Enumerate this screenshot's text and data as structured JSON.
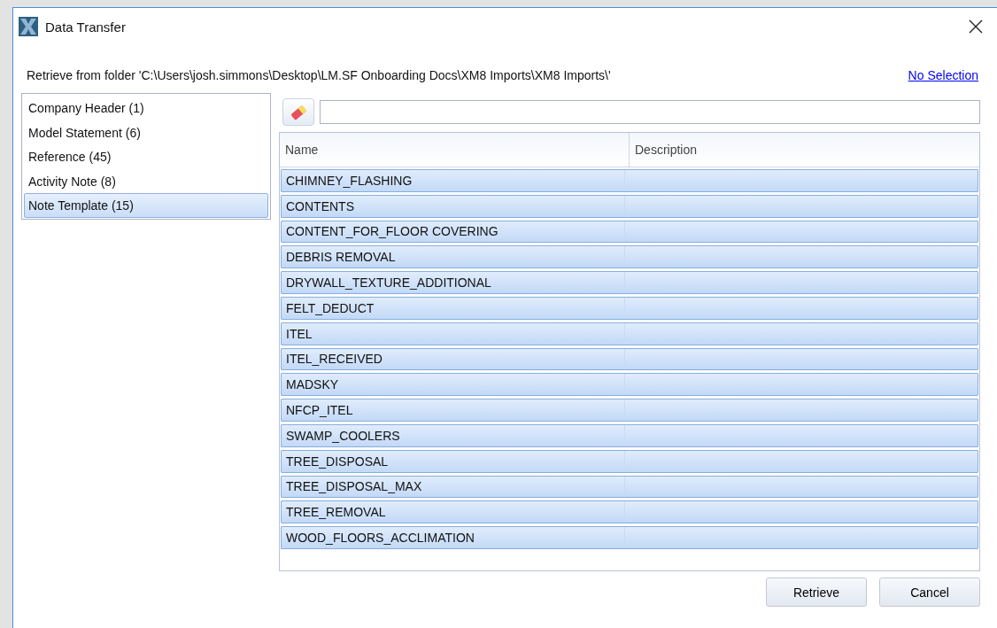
{
  "window": {
    "title": "Data Transfer"
  },
  "path_label": "Retrieve from folder 'C:\\Users\\josh.simmons\\Desktop\\LM.SF Onboarding Docs\\XM8 Imports\\XM8 Imports\\'",
  "no_selection_link": "No Selection",
  "categories": [
    {
      "label": "Company Header (1)",
      "selected": false
    },
    {
      "label": "Model Statement (6)",
      "selected": false
    },
    {
      "label": "Reference (45)",
      "selected": false
    },
    {
      "label": "Activity Note (8)",
      "selected": false
    },
    {
      "label": "Note Template (15)",
      "selected": true
    }
  ],
  "table": {
    "columns": [
      "Name",
      "Description"
    ],
    "rows": [
      {
        "name": "CHIMNEY_FLASHING",
        "selected": true
      },
      {
        "name": "CONTENTS",
        "selected": true
      },
      {
        "name": "CONTENT_FOR_FLOOR COVERING",
        "selected": true
      },
      {
        "name": "DEBRIS REMOVAL",
        "selected": true
      },
      {
        "name": "DRYWALL_TEXTURE_ADDITIONAL",
        "selected": true
      },
      {
        "name": "FELT_DEDUCT",
        "selected": true
      },
      {
        "name": "ITEL",
        "selected": true
      },
      {
        "name": "ITEL_RECEIVED",
        "selected": true
      },
      {
        "name": "MADSKY",
        "selected": true
      },
      {
        "name": "NFCP_ITEL",
        "selected": true
      },
      {
        "name": "SWAMP_COOLERS",
        "selected": true
      },
      {
        "name": "TREE_DISPOSAL",
        "selected": true
      },
      {
        "name": "TREE_DISPOSAL_MAX",
        "selected": true
      },
      {
        "name": "TREE_REMOVAL",
        "selected": true
      },
      {
        "name": "WOOD_FLOORS_ACCLIMATION",
        "selected": true
      }
    ]
  },
  "buttons": [
    "Retrieve",
    "Cancel"
  ]
}
